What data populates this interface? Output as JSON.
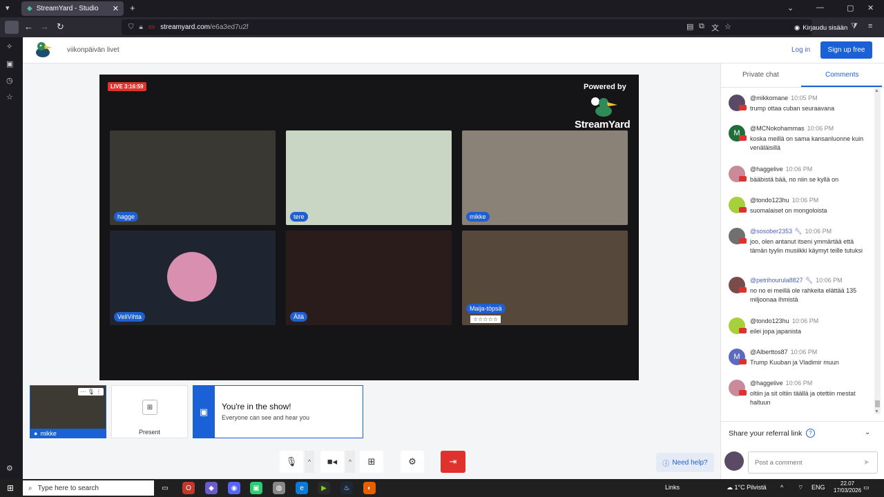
{
  "browser": {
    "tab_title": "StreamYard - Studio",
    "url_host": "streamyard.com",
    "url_path": "/e6a3ed7u2f",
    "login_chip": "Kirjaudu sisään"
  },
  "header": {
    "brand_name": "viikonpäivän livet",
    "login": "Log in",
    "signup": "Sign up free"
  },
  "stage": {
    "live_badge": "LIVE 3:16:59",
    "powered_by": "Powered by",
    "logo_text": "StreamYard",
    "tiles": [
      {
        "name": "hagge",
        "bg": "#3a3833"
      },
      {
        "name": "tere",
        "bg": "#c9d6c4"
      },
      {
        "name": "mikke",
        "bg": "#8a8276"
      },
      {
        "name": "VeliVihta",
        "bg": "#1f2530"
      },
      {
        "name": "Ällä",
        "bg": "#2b1c1c"
      },
      {
        "name": "Maija-töpsä",
        "bg": "#57483c",
        "stars": "☆☆☆☆☆"
      }
    ]
  },
  "strip": {
    "self_name": "mikke",
    "present_label": "Present",
    "show_title": "You're in the show!",
    "show_sub": "Everyone can see and hear you"
  },
  "controls": {
    "help": "Need help?"
  },
  "panel": {
    "tab_private": "Private chat",
    "tab_comments": "Comments",
    "comments": [
      {
        "user": "@mikkomane",
        "time": "10:05 PM",
        "text": "trump ottaa cuban seuraavana",
        "avatar_color": "#5b4a66",
        "initial": ""
      },
      {
        "user": "@MCNokohammas",
        "time": "10:06 PM",
        "text": "koska meillä on sama kansanluonne kuin venäläisillä",
        "avatar_color": "#1f6e3a",
        "initial": "M"
      },
      {
        "user": "@haggelive",
        "time": "10:06 PM",
        "text": "bääbistä bää, no niin se kyllä on",
        "avatar_color": "#c98a9a",
        "initial": ""
      },
      {
        "user": "@tondo123hu",
        "time": "10:06 PM",
        "text": "suomalaiset on mongoloista",
        "avatar_color": "#a6d13b",
        "initial": ""
      },
      {
        "user": "@sosober2353",
        "time": "10:06 PM",
        "text": "joo, olen antanut itseni ymmärtää että tämän tyylin musiikki käymyt teille tutuksi",
        "avatar_color": "#707070",
        "initial": "",
        "mod": true
      },
      {
        "user": "@petrihourula8827",
        "time": "10:06 PM",
        "text": "no no ei meillä ole rahkeita elättää 135 miljoonaa ihmistä",
        "avatar_color": "#7a4b4b",
        "initial": "",
        "mod": true
      },
      {
        "user": "@tondo123hu",
        "time": "10:06 PM",
        "text": "eilei jopa japanista",
        "avatar_color": "#a6d13b",
        "initial": ""
      },
      {
        "user": "@Alberttos87",
        "time": "10:06 PM",
        "text": "Trump Kuuban ja Vladimir muun",
        "avatar_color": "#5c6bc0",
        "initial": "M"
      },
      {
        "user": "@haggelive",
        "time": "10:06 PM",
        "text": "oltiin ja sit oltiin täällä ja otettiin mestat haltuun",
        "avatar_color": "#c98a9a",
        "initial": ""
      }
    ],
    "referral": "Share your referral link",
    "post_placeholder": "Post a comment"
  },
  "taskbar": {
    "search": "Type here to search",
    "links": "Links",
    "weather": "1°C Pilvistä",
    "lang": "ENG",
    "time": "22.07",
    "date": "17/03/2026"
  },
  "colors": {
    "accent": "#1a60d6",
    "live_red": "#e0322d",
    "stage_bg": "#151517"
  }
}
